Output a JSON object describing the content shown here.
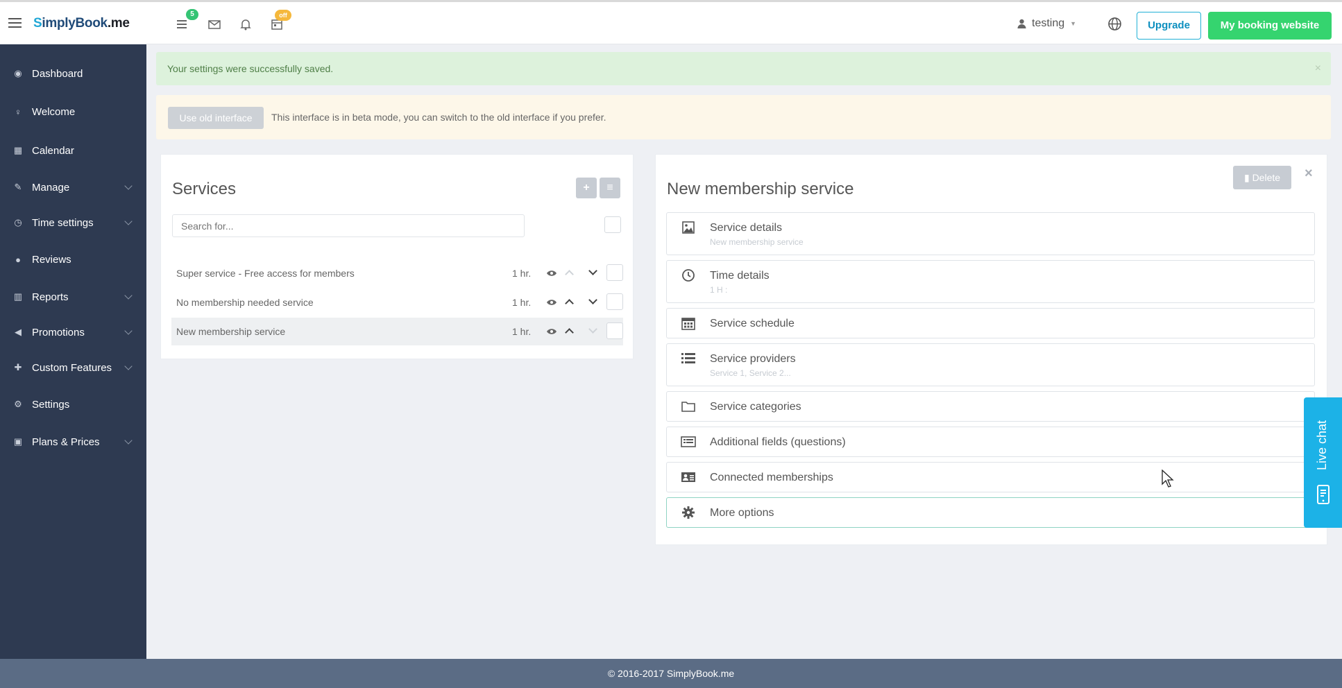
{
  "topbar": {
    "logo": {
      "s": "S",
      "rest": "implyBook",
      "suffix": ".me"
    },
    "badges": {
      "tasks": "5",
      "calendar": "off"
    },
    "user": "testing",
    "upgrade_label": "Upgrade",
    "site_label": "My booking website"
  },
  "sidebar": {
    "items": [
      {
        "label": "Dashboard",
        "icon": "dashboard-icon"
      },
      {
        "label": "Welcome",
        "icon": "lightbulb-icon"
      },
      {
        "label": "Calendar",
        "icon": "calendar-icon"
      },
      {
        "label": "Manage",
        "icon": "pencil-icon",
        "expandable": true
      },
      {
        "label": "Time settings",
        "icon": "clock-icon",
        "expandable": true
      },
      {
        "label": "Reviews",
        "icon": "comments-icon"
      },
      {
        "label": "Reports",
        "icon": "bar-chart-icon",
        "expandable": true
      },
      {
        "label": "Promotions",
        "icon": "bullhorn-icon",
        "expandable": true
      },
      {
        "label": "Custom Features",
        "icon": "puzzle-icon",
        "expandable": true
      },
      {
        "label": "Settings",
        "icon": "gears-icon"
      },
      {
        "label": "Plans & Prices",
        "icon": "money-icon",
        "expandable": true
      }
    ]
  },
  "alerts": {
    "success": "Your settings were successfully saved.",
    "beta_button": "Use old interface",
    "beta_text": "This interface is in beta mode, you can switch to the old interface if you prefer."
  },
  "services": {
    "title": "Services",
    "search_placeholder": "Search for...",
    "rows": [
      {
        "name": "Super service - Free access for members",
        "duration": "1 hr."
      },
      {
        "name": "No membership needed service",
        "duration": "1 hr."
      },
      {
        "name": "New membership service",
        "duration": "1 hr."
      }
    ]
  },
  "detail": {
    "title": "New membership service",
    "delete_label": "Delete",
    "sections": [
      {
        "title": "Service details",
        "sub": "New membership service"
      },
      {
        "title": "Time details",
        "sub": "1 H :"
      },
      {
        "title": "Service schedule",
        "sub": ""
      },
      {
        "title": "Service providers",
        "sub": "Service 1, Service 2..."
      },
      {
        "title": "Service categories",
        "sub": ""
      },
      {
        "title": "Additional fields (questions)",
        "sub": ""
      },
      {
        "title": "Connected memberships",
        "sub": ""
      },
      {
        "title": "More options",
        "sub": ""
      }
    ]
  },
  "live_chat": "Live chat",
  "footer": "© 2016-2017 SimplyBook.me"
}
